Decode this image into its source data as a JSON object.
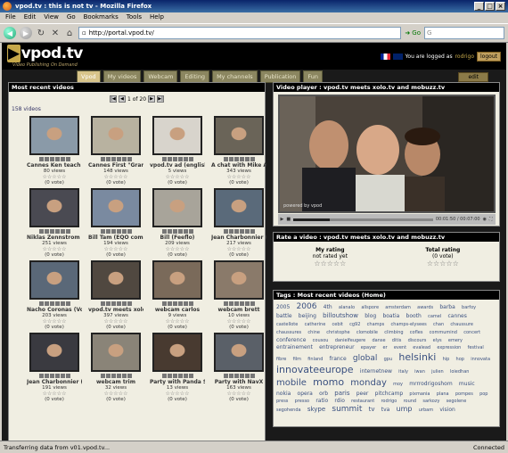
{
  "window": {
    "title": "vpod.tv : this is not tv - Mozilla Firefox"
  },
  "menu": [
    {
      "label": "File"
    },
    {
      "label": "Edit"
    },
    {
      "label": "View"
    },
    {
      "label": "Go"
    },
    {
      "label": "Bookmarks"
    },
    {
      "label": "Tools"
    },
    {
      "label": "Help"
    }
  ],
  "nav": {
    "url": "http://portal.vpod.tv/",
    "go_label": "Go"
  },
  "site": {
    "logo": "vpod.tv",
    "tagline": "Video Publishing On Demand",
    "logged_prefix": "You are logged as",
    "username": "rodrigo",
    "logout_label": "logout"
  },
  "tabs": [
    {
      "label": "Vpod"
    },
    {
      "label": "My videos"
    },
    {
      "label": "Webcam"
    },
    {
      "label": "Editing"
    },
    {
      "label": "My channels"
    },
    {
      "label": "Publication"
    },
    {
      "label": "Fun"
    }
  ],
  "edit_label": "edit",
  "recent": {
    "heading": "Most recent videos",
    "pager": "1 of 20",
    "count": "158 videos",
    "videos": [
      {
        "title": "Cannes Ken teach He",
        "views": "80 views",
        "votes": "(0 vote)"
      },
      {
        "title": "Cannes First \"Grand J",
        "views": "148 views",
        "votes": "(0 vote)"
      },
      {
        "title": "vpod.tv ad (english)",
        "views": "5 views",
        "votes": "(0 vote)"
      },
      {
        "title": "A chat with Mike Arrin",
        "views": "343 views",
        "votes": "(0 vote)"
      },
      {
        "title": "Niklas Zennstrom reco",
        "views": "251 views",
        "votes": "(0 vote)"
      },
      {
        "title": "Bill Tam (EQO commun",
        "views": "194 views",
        "votes": "(0 vote)"
      },
      {
        "title": "Bill (Feeflo)",
        "views": "209 views",
        "votes": "(0 vote)"
      },
      {
        "title": "Jean Charbonnier (Ne",
        "views": "217 views",
        "votes": "(0 vote)"
      },
      {
        "title": "Nacho Coronas (Voxp",
        "views": "203 views",
        "votes": "(0 vote)"
      },
      {
        "title": "vpod.tv meets xolo.tv",
        "views": "397 views",
        "votes": "(0 vote)"
      },
      {
        "title": "webcam carlos",
        "views": "9 views",
        "votes": "(0 vote)"
      },
      {
        "title": "webcam brett",
        "views": "10 views",
        "votes": "(0 vote)"
      },
      {
        "title": "Jean Charbonnier (Ne",
        "views": "191 views",
        "votes": "(0 vote)"
      },
      {
        "title": "webcam trim",
        "views": "32 views",
        "votes": "(0 vote)"
      },
      {
        "title": "Party with Panda Sof",
        "views": "13 views",
        "votes": "(0 vote)"
      },
      {
        "title": "Party with NavX",
        "views": "163 views",
        "votes": "(0 vote)"
      }
    ],
    "thumb_colors": [
      "#8a9aa8",
      "#b8b2a0",
      "#d8d4cc",
      "#6a6458",
      "#4a4a52",
      "#7a8aa0",
      "#a8a49a",
      "#5a6a7a",
      "#5a6878",
      "#504840",
      "#7a6a5a",
      "#8a7a6a",
      "#3a3a40",
      "#8a8478",
      "#483a30",
      "#5a6068"
    ]
  },
  "player": {
    "heading": "Video player : vpod.tv meets xolo.tv and mobuzz.tv",
    "time": "00:01:50 / 00:07:00",
    "powered": "powered by vpod"
  },
  "rating": {
    "heading": "Rate a video : vpod.tv meets xolo.tv and mobuzz.tv",
    "my_label": "My rating",
    "my_status": "not rated yet",
    "total_label": "Total rating",
    "total_votes": "(0 vote)"
  },
  "tags": {
    "heading": "Tags : Most recent videos (Home)",
    "cloud": [
      {
        "t": "2005",
        "s": 6
      },
      {
        "t": "2006",
        "s": 9
      },
      {
        "t": "4th",
        "s": 6
      },
      {
        "t": "alanalo",
        "s": 5
      },
      {
        "t": "allspore",
        "s": 5
      },
      {
        "t": "amsterdam",
        "s": 5
      },
      {
        "t": "awards",
        "s": 5
      },
      {
        "t": "barba",
        "s": 6
      },
      {
        "t": "barfoy",
        "s": 5
      },
      {
        "t": "battle",
        "s": 6
      },
      {
        "t": "beijing",
        "s": 6
      },
      {
        "t": "billoutshow",
        "s": 7
      },
      {
        "t": "blog",
        "s": 6
      },
      {
        "t": "boatia",
        "s": 6
      },
      {
        "t": "booth",
        "s": 6
      },
      {
        "t": "camel",
        "s": 5
      },
      {
        "t": "cannes",
        "s": 6
      },
      {
        "t": "castellote",
        "s": 5
      },
      {
        "t": "catherine",
        "s": 5
      },
      {
        "t": "cebit",
        "s": 5
      },
      {
        "t": "cg92",
        "s": 5
      },
      {
        "t": "champs",
        "s": 5
      },
      {
        "t": "champs-elysees",
        "s": 5
      },
      {
        "t": "chan",
        "s": 5
      },
      {
        "t": "chaussure",
        "s": 5
      },
      {
        "t": "chaussures",
        "s": 5
      },
      {
        "t": "chine",
        "s": 5
      },
      {
        "t": "christophe",
        "s": 5
      },
      {
        "t": "clomobile",
        "s": 5
      },
      {
        "t": "climbing",
        "s": 5
      },
      {
        "t": "cofles",
        "s": 5
      },
      {
        "t": "commumind",
        "s": 5
      },
      {
        "t": "concert",
        "s": 5
      },
      {
        "t": "conference",
        "s": 6
      },
      {
        "t": "cousou",
        "s": 5
      },
      {
        "t": "danielfeugere",
        "s": 5
      },
      {
        "t": "danse",
        "s": 5
      },
      {
        "t": "ditis",
        "s": 5
      },
      {
        "t": "discours",
        "s": 5
      },
      {
        "t": "elys",
        "s": 5
      },
      {
        "t": "emery",
        "s": 5
      },
      {
        "t": "entrainement",
        "s": 6
      },
      {
        "t": "entrepreneur",
        "s": 6
      },
      {
        "t": "epayer",
        "s": 5
      },
      {
        "t": "er",
        "s": 5
      },
      {
        "t": "event",
        "s": 5
      },
      {
        "t": "evalead",
        "s": 5
      },
      {
        "t": "expression",
        "s": 5
      },
      {
        "t": "festival",
        "s": 5
      },
      {
        "t": "fibre",
        "s": 5
      },
      {
        "t": "film",
        "s": 5
      },
      {
        "t": "finland",
        "s": 5
      },
      {
        "t": "france",
        "s": 6
      },
      {
        "t": "global",
        "s": 9
      },
      {
        "t": "gpu",
        "s": 5
      },
      {
        "t": "helsinki",
        "s": 11
      },
      {
        "t": "hip",
        "s": 5
      },
      {
        "t": "hop",
        "s": 5
      },
      {
        "t": "innovata",
        "s": 5
      },
      {
        "t": "innovateeurope",
        "s": 11
      },
      {
        "t": "internetnew",
        "s": 6
      },
      {
        "t": "italy",
        "s": 5
      },
      {
        "t": "iwan",
        "s": 5
      },
      {
        "t": "julien",
        "s": 5
      },
      {
        "t": "loiedhan",
        "s": 5
      },
      {
        "t": "mobile",
        "s": 10
      },
      {
        "t": "momo",
        "s": 11
      },
      {
        "t": "monday",
        "s": 10
      },
      {
        "t": "moy",
        "s": 5
      },
      {
        "t": "mrrrodrigoshom",
        "s": 6
      },
      {
        "t": "music",
        "s": 6
      },
      {
        "t": "nokia",
        "s": 6
      },
      {
        "t": "opera",
        "s": 6
      },
      {
        "t": "orb",
        "s": 6
      },
      {
        "t": "paris",
        "s": 7
      },
      {
        "t": "peer",
        "s": 6
      },
      {
        "t": "pitchcamp",
        "s": 6
      },
      {
        "t": "pixmania",
        "s": 5
      },
      {
        "t": "plana",
        "s": 5
      },
      {
        "t": "pompes",
        "s": 5
      },
      {
        "t": "pop",
        "s": 5
      },
      {
        "t": "press",
        "s": 5
      },
      {
        "t": "presso",
        "s": 5
      },
      {
        "t": "ratio",
        "s": 6
      },
      {
        "t": "rdio",
        "s": 6
      },
      {
        "t": "restaurant",
        "s": 5
      },
      {
        "t": "rodrigo",
        "s": 5
      },
      {
        "t": "round",
        "s": 5
      },
      {
        "t": "sarkozy",
        "s": 5
      },
      {
        "t": "segolene",
        "s": 5
      },
      {
        "t": "segohenda",
        "s": 5
      },
      {
        "t": "skype",
        "s": 7
      },
      {
        "t": "summit",
        "s": 9
      },
      {
        "t": "tv",
        "s": 7
      },
      {
        "t": "tva",
        "s": 6
      },
      {
        "t": "ump",
        "s": 8
      },
      {
        "t": "urbam",
        "s": 5
      },
      {
        "t": "vision",
        "s": 6
      }
    ]
  },
  "status": {
    "left": "Transferring data from v01.vpod.tv...",
    "right": "Connected"
  },
  "colors": {
    "accent": "#d8c48a",
    "panel": "#f0eee2",
    "tag": "#3a5080"
  }
}
